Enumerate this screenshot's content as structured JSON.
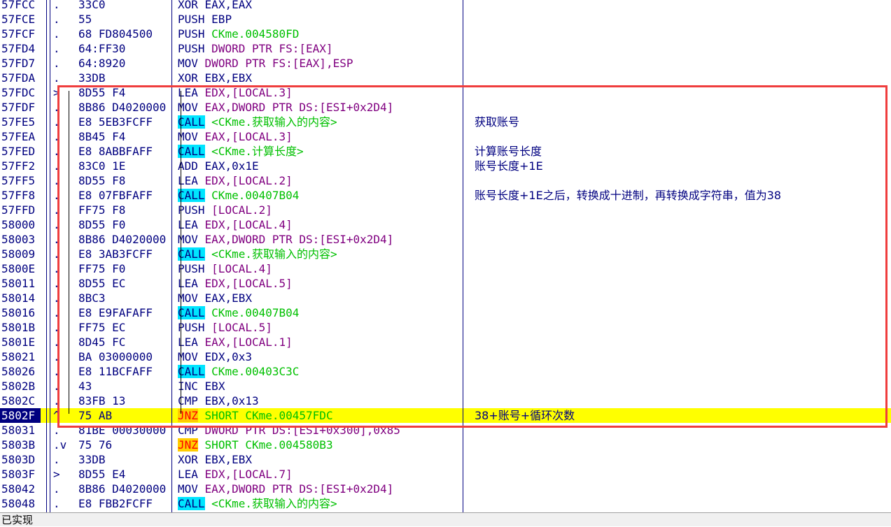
{
  "rows": [
    {
      "addr": "57FCC",
      "mark": ".",
      "hex": "33C0",
      "mnemonic": "XOR",
      "operand": "EAX,EAX",
      "mn_style": "plain",
      "op_style": "plain",
      "comment": ""
    },
    {
      "addr": "57FCE",
      "mark": ".",
      "hex": "55",
      "mnemonic": "PUSH",
      "operand": "EBP",
      "mn_style": "plain",
      "op_style": "plain",
      "comment": ""
    },
    {
      "addr": "57FCF",
      "mark": ".",
      "hex": "68 FD804500",
      "mnemonic": "PUSH",
      "operand": "CKme.004580FD",
      "mn_style": "plain",
      "op_style": "green",
      "comment": ""
    },
    {
      "addr": "57FD4",
      "mark": ".",
      "hex": "64:FF30",
      "mnemonic": "PUSH",
      "operand": "DWORD PTR FS:[EAX]",
      "mn_style": "plain",
      "op_style": "purple",
      "comment": ""
    },
    {
      "addr": "57FD7",
      "mark": ".",
      "hex": "64:8920",
      "mnemonic": "MOV",
      "operand": "DWORD PTR FS:[EAX],ESP",
      "mn_style": "plain",
      "op_style": "purple",
      "comment": ""
    },
    {
      "addr": "57FDA",
      "mark": ".",
      "hex": "33DB",
      "mnemonic": "XOR",
      "operand": "EBX,EBX",
      "mn_style": "plain",
      "op_style": "plain",
      "comment": ""
    },
    {
      "addr": "57FDC",
      "mark": ">",
      "hex": "8D55 F4",
      "mnemonic": "LEA",
      "operand": "EDX,[LOCAL.3]",
      "mn_style": "plain",
      "op_style": "purple",
      "comment": ""
    },
    {
      "addr": "57FDF",
      "mark": ".",
      "hex": "8B86 D4020000",
      "mnemonic": "MOV",
      "operand": "EAX,DWORD PTR DS:[ESI+0x2D4]",
      "mn_style": "plain",
      "op_style": "purple",
      "comment": ""
    },
    {
      "addr": "57FE5",
      "mark": ".",
      "hex": "E8 5EB3FCFF",
      "mnemonic": "CALL",
      "operand": "<CKme.获取输入的内容>",
      "mn_style": "call",
      "op_style": "green",
      "comment": "获取账号"
    },
    {
      "addr": "57FEA",
      "mark": ".",
      "hex": "8B45 F4",
      "mnemonic": "MOV",
      "operand": "EAX,[LOCAL.3]",
      "mn_style": "plain",
      "op_style": "purple",
      "comment": ""
    },
    {
      "addr": "57FED",
      "mark": ".",
      "hex": "E8 8ABBFAFF",
      "mnemonic": "CALL",
      "operand": "<CKme.计算长度>",
      "mn_style": "call",
      "op_style": "green",
      "comment": "计算账号长度"
    },
    {
      "addr": "57FF2",
      "mark": ".",
      "hex": "83C0 1E",
      "mnemonic": "ADD",
      "operand": "EAX,0x1E",
      "mn_style": "plain",
      "op_style": "plain",
      "comment": "账号长度+1E"
    },
    {
      "addr": "57FF5",
      "mark": ".",
      "hex": "8D55 F8",
      "mnemonic": "LEA",
      "operand": "EDX,[LOCAL.2]",
      "mn_style": "plain",
      "op_style": "purple",
      "comment": ""
    },
    {
      "addr": "57FF8",
      "mark": ".",
      "hex": "E8 07FBFAFF",
      "mnemonic": "CALL",
      "operand": "CKme.00407B04",
      "mn_style": "call",
      "op_style": "green",
      "comment": "账号长度+1E之后，转换成十进制，再转换成字符串，值为38"
    },
    {
      "addr": "57FFD",
      "mark": ".",
      "hex": "FF75 F8",
      "mnemonic": "PUSH",
      "operand": "[LOCAL.2]",
      "mn_style": "plain",
      "op_style": "purple",
      "comment": ""
    },
    {
      "addr": "58000",
      "mark": ".",
      "hex": "8D55 F0",
      "mnemonic": "LEA",
      "operand": "EDX,[LOCAL.4]",
      "mn_style": "plain",
      "op_style": "purple",
      "comment": ""
    },
    {
      "addr": "58003",
      "mark": ".",
      "hex": "8B86 D4020000",
      "mnemonic": "MOV",
      "operand": "EAX,DWORD PTR DS:[ESI+0x2D4]",
      "mn_style": "plain",
      "op_style": "purple",
      "comment": ""
    },
    {
      "addr": "58009",
      "mark": ".",
      "hex": "E8 3AB3FCFF",
      "mnemonic": "CALL",
      "operand": "<CKme.获取输入的内容>",
      "mn_style": "call",
      "op_style": "green",
      "comment": ""
    },
    {
      "addr": "5800E",
      "mark": ".",
      "hex": "FF75 F0",
      "mnemonic": "PUSH",
      "operand": "[LOCAL.4]",
      "mn_style": "plain",
      "op_style": "purple",
      "comment": ""
    },
    {
      "addr": "58011",
      "mark": ".",
      "hex": "8D55 EC",
      "mnemonic": "LEA",
      "operand": "EDX,[LOCAL.5]",
      "mn_style": "plain",
      "op_style": "purple",
      "comment": ""
    },
    {
      "addr": "58014",
      "mark": ".",
      "hex": "8BC3",
      "mnemonic": "MOV",
      "operand": "EAX,EBX",
      "mn_style": "plain",
      "op_style": "plain",
      "comment": ""
    },
    {
      "addr": "58016",
      "mark": ".",
      "hex": "E8 E9FAFAFF",
      "mnemonic": "CALL",
      "operand": "CKme.00407B04",
      "mn_style": "call",
      "op_style": "green",
      "comment": ""
    },
    {
      "addr": "5801B",
      "mark": ".",
      "hex": "FF75 EC",
      "mnemonic": "PUSH",
      "operand": "[LOCAL.5]",
      "mn_style": "plain",
      "op_style": "purple",
      "comment": ""
    },
    {
      "addr": "5801E",
      "mark": ".",
      "hex": "8D45 FC",
      "mnemonic": "LEA",
      "operand": "EAX,[LOCAL.1]",
      "mn_style": "plain",
      "op_style": "purple",
      "comment": ""
    },
    {
      "addr": "58021",
      "mark": ".",
      "hex": "BA 03000000",
      "mnemonic": "MOV",
      "operand": "EDX,0x3",
      "mn_style": "plain",
      "op_style": "plain",
      "comment": ""
    },
    {
      "addr": "58026",
      "mark": ".",
      "hex": "E8 11BCFAFF",
      "mnemonic": "CALL",
      "operand": "CKme.00403C3C",
      "mn_style": "call",
      "op_style": "green",
      "comment": ""
    },
    {
      "addr": "5802B",
      "mark": ".",
      "hex": "43",
      "mnemonic": "INC",
      "operand": "EBX",
      "mn_style": "plain",
      "op_style": "plain",
      "comment": ""
    },
    {
      "addr": "5802C",
      "mark": ".",
      "hex": "83FB 13",
      "mnemonic": "CMP",
      "operand": "EBX,0x13",
      "mn_style": "plain",
      "op_style": "plain",
      "comment": ""
    },
    {
      "addr": "5802F",
      "mark": "^",
      "hex": "75 AB",
      "mnemonic": "JNZ",
      "operand": "SHORT CKme.00457FDC",
      "mn_style": "jnz",
      "op_style": "green",
      "comment": "38+账号+循环次数"
    },
    {
      "addr": "58031",
      "mark": ".",
      "hex": "81BE 00030000",
      "mnemonic": "CMP",
      "operand": "DWORD PTR DS:[ESI+0x300],0x85",
      "mn_style": "plain",
      "op_style": "purple",
      "comment": ""
    },
    {
      "addr": "5803B",
      "mark": ".v",
      "hex": "75 76",
      "mnemonic": "JNZ",
      "operand": "SHORT CKme.004580B3",
      "mn_style": "jnz",
      "op_style": "green",
      "comment": ""
    },
    {
      "addr": "5803D",
      "mark": ".",
      "hex": "33DB",
      "mnemonic": "XOR",
      "operand": "EBX,EBX",
      "mn_style": "plain",
      "op_style": "plain",
      "comment": ""
    },
    {
      "addr": "5803F",
      "mark": ">",
      "hex": "8D55 E4",
      "mnemonic": "LEA",
      "operand": "EDX,[LOCAL.7]",
      "mn_style": "plain",
      "op_style": "purple",
      "comment": ""
    },
    {
      "addr": "58042",
      "mark": ".",
      "hex": "8B86 D4020000",
      "mnemonic": "MOV",
      "operand": "EAX,DWORD PTR DS:[ESI+0x2D4]",
      "mn_style": "plain",
      "op_style": "purple",
      "comment": ""
    },
    {
      "addr": "58048",
      "mark": ".",
      "hex": "E8 FBB2FCFF",
      "mnemonic": "CALL",
      "operand": "<CKme.获取输入的内容>",
      "mn_style": "call",
      "op_style": "green",
      "comment": ""
    }
  ],
  "selected_addr": "5802F",
  "highlighted_addr": "5802F",
  "statusbar": {
    "text": "已实现"
  },
  "colors": {
    "highlight": "#ffff00",
    "call_bg": "#00e5ff",
    "jnz_bg": "#ffcc00",
    "annotation_box": "#ef3d3d",
    "selection": "#000080"
  }
}
